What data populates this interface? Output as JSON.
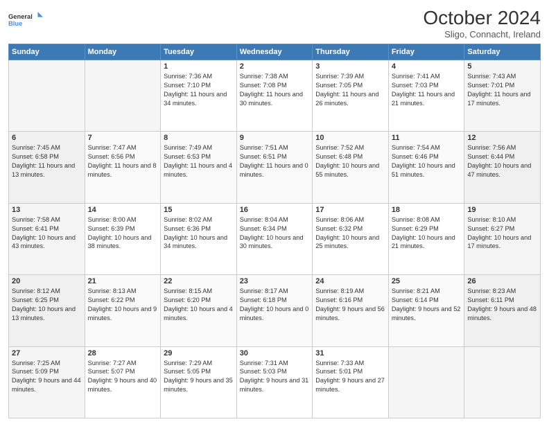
{
  "header": {
    "logo_line1": "General",
    "logo_line2": "Blue",
    "month": "October 2024",
    "location": "Sligo, Connacht, Ireland"
  },
  "weekdays": [
    "Sunday",
    "Monday",
    "Tuesday",
    "Wednesday",
    "Thursday",
    "Friday",
    "Saturday"
  ],
  "weeks": [
    [
      {
        "day": "",
        "sunrise": "",
        "sunset": "",
        "daylight": ""
      },
      {
        "day": "",
        "sunrise": "",
        "sunset": "",
        "daylight": ""
      },
      {
        "day": "1",
        "sunrise": "Sunrise: 7:36 AM",
        "sunset": "Sunset: 7:10 PM",
        "daylight": "Daylight: 11 hours and 34 minutes."
      },
      {
        "day": "2",
        "sunrise": "Sunrise: 7:38 AM",
        "sunset": "Sunset: 7:08 PM",
        "daylight": "Daylight: 11 hours and 30 minutes."
      },
      {
        "day": "3",
        "sunrise": "Sunrise: 7:39 AM",
        "sunset": "Sunset: 7:05 PM",
        "daylight": "Daylight: 11 hours and 26 minutes."
      },
      {
        "day": "4",
        "sunrise": "Sunrise: 7:41 AM",
        "sunset": "Sunset: 7:03 PM",
        "daylight": "Daylight: 11 hours and 21 minutes."
      },
      {
        "day": "5",
        "sunrise": "Sunrise: 7:43 AM",
        "sunset": "Sunset: 7:01 PM",
        "daylight": "Daylight: 11 hours and 17 minutes."
      }
    ],
    [
      {
        "day": "6",
        "sunrise": "Sunrise: 7:45 AM",
        "sunset": "Sunset: 6:58 PM",
        "daylight": "Daylight: 11 hours and 13 minutes."
      },
      {
        "day": "7",
        "sunrise": "Sunrise: 7:47 AM",
        "sunset": "Sunset: 6:56 PM",
        "daylight": "Daylight: 11 hours and 8 minutes."
      },
      {
        "day": "8",
        "sunrise": "Sunrise: 7:49 AM",
        "sunset": "Sunset: 6:53 PM",
        "daylight": "Daylight: 11 hours and 4 minutes."
      },
      {
        "day": "9",
        "sunrise": "Sunrise: 7:51 AM",
        "sunset": "Sunset: 6:51 PM",
        "daylight": "Daylight: 11 hours and 0 minutes."
      },
      {
        "day": "10",
        "sunrise": "Sunrise: 7:52 AM",
        "sunset": "Sunset: 6:48 PM",
        "daylight": "Daylight: 10 hours and 55 minutes."
      },
      {
        "day": "11",
        "sunrise": "Sunrise: 7:54 AM",
        "sunset": "Sunset: 6:46 PM",
        "daylight": "Daylight: 10 hours and 51 minutes."
      },
      {
        "day": "12",
        "sunrise": "Sunrise: 7:56 AM",
        "sunset": "Sunset: 6:44 PM",
        "daylight": "Daylight: 10 hours and 47 minutes."
      }
    ],
    [
      {
        "day": "13",
        "sunrise": "Sunrise: 7:58 AM",
        "sunset": "Sunset: 6:41 PM",
        "daylight": "Daylight: 10 hours and 43 minutes."
      },
      {
        "day": "14",
        "sunrise": "Sunrise: 8:00 AM",
        "sunset": "Sunset: 6:39 PM",
        "daylight": "Daylight: 10 hours and 38 minutes."
      },
      {
        "day": "15",
        "sunrise": "Sunrise: 8:02 AM",
        "sunset": "Sunset: 6:36 PM",
        "daylight": "Daylight: 10 hours and 34 minutes."
      },
      {
        "day": "16",
        "sunrise": "Sunrise: 8:04 AM",
        "sunset": "Sunset: 6:34 PM",
        "daylight": "Daylight: 10 hours and 30 minutes."
      },
      {
        "day": "17",
        "sunrise": "Sunrise: 8:06 AM",
        "sunset": "Sunset: 6:32 PM",
        "daylight": "Daylight: 10 hours and 25 minutes."
      },
      {
        "day": "18",
        "sunrise": "Sunrise: 8:08 AM",
        "sunset": "Sunset: 6:29 PM",
        "daylight": "Daylight: 10 hours and 21 minutes."
      },
      {
        "day": "19",
        "sunrise": "Sunrise: 8:10 AM",
        "sunset": "Sunset: 6:27 PM",
        "daylight": "Daylight: 10 hours and 17 minutes."
      }
    ],
    [
      {
        "day": "20",
        "sunrise": "Sunrise: 8:12 AM",
        "sunset": "Sunset: 6:25 PM",
        "daylight": "Daylight: 10 hours and 13 minutes."
      },
      {
        "day": "21",
        "sunrise": "Sunrise: 8:13 AM",
        "sunset": "Sunset: 6:22 PM",
        "daylight": "Daylight: 10 hours and 9 minutes."
      },
      {
        "day": "22",
        "sunrise": "Sunrise: 8:15 AM",
        "sunset": "Sunset: 6:20 PM",
        "daylight": "Daylight: 10 hours and 4 minutes."
      },
      {
        "day": "23",
        "sunrise": "Sunrise: 8:17 AM",
        "sunset": "Sunset: 6:18 PM",
        "daylight": "Daylight: 10 hours and 0 minutes."
      },
      {
        "day": "24",
        "sunrise": "Sunrise: 8:19 AM",
        "sunset": "Sunset: 6:16 PM",
        "daylight": "Daylight: 9 hours and 56 minutes."
      },
      {
        "day": "25",
        "sunrise": "Sunrise: 8:21 AM",
        "sunset": "Sunset: 6:14 PM",
        "daylight": "Daylight: 9 hours and 52 minutes."
      },
      {
        "day": "26",
        "sunrise": "Sunrise: 8:23 AM",
        "sunset": "Sunset: 6:11 PM",
        "daylight": "Daylight: 9 hours and 48 minutes."
      }
    ],
    [
      {
        "day": "27",
        "sunrise": "Sunrise: 7:25 AM",
        "sunset": "Sunset: 5:09 PM",
        "daylight": "Daylight: 9 hours and 44 minutes."
      },
      {
        "day": "28",
        "sunrise": "Sunrise: 7:27 AM",
        "sunset": "Sunset: 5:07 PM",
        "daylight": "Daylight: 9 hours and 40 minutes."
      },
      {
        "day": "29",
        "sunrise": "Sunrise: 7:29 AM",
        "sunset": "Sunset: 5:05 PM",
        "daylight": "Daylight: 9 hours and 35 minutes."
      },
      {
        "day": "30",
        "sunrise": "Sunrise: 7:31 AM",
        "sunset": "Sunset: 5:03 PM",
        "daylight": "Daylight: 9 hours and 31 minutes."
      },
      {
        "day": "31",
        "sunrise": "Sunrise: 7:33 AM",
        "sunset": "Sunset: 5:01 PM",
        "daylight": "Daylight: 9 hours and 27 minutes."
      },
      {
        "day": "",
        "sunrise": "",
        "sunset": "",
        "daylight": ""
      },
      {
        "day": "",
        "sunrise": "",
        "sunset": "",
        "daylight": ""
      }
    ]
  ]
}
